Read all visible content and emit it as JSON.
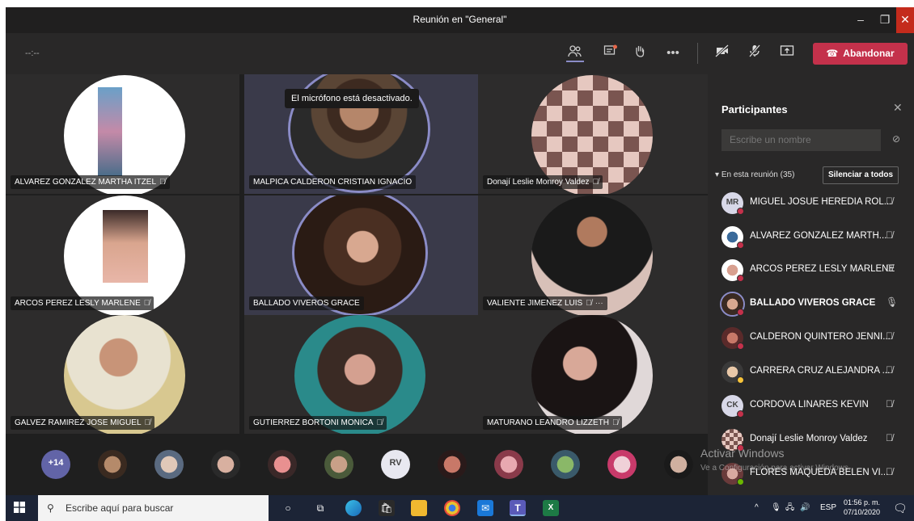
{
  "window": {
    "title": "Reunión en \"General\"",
    "minimize_icon": "minimize-icon",
    "maximize_icon": "maximize-icon",
    "close_icon": "close-icon"
  },
  "toolbar": {
    "timer": "--:--",
    "leave_label": "Abandonar",
    "leave_color": "#c4314b"
  },
  "tooltip": "El micrófono está desactivado.",
  "tiles": [
    {
      "name": "ALVAREZ GONZALEZ MARTHA ITZEL"
    },
    {
      "name": "MALPICA CALDERON CRISTIAN IGNACIO"
    },
    {
      "name": "Donají Leslie Monroy Valdez"
    },
    {
      "name": "ARCOS PEREZ LESLY MARLENE"
    },
    {
      "name": "BALLADO VIVEROS GRACE"
    },
    {
      "name": "VALIENTE JIMENEZ LUIS"
    },
    {
      "name": "GALVEZ RAMIREZ JOSE MIGUEL"
    },
    {
      "name": "GUTIERREZ BORTONI MONICA"
    },
    {
      "name": "MATURANO LEANDRO LIZZETH"
    }
  ],
  "strip": {
    "more_count": "+14",
    "initials_rv": "RV"
  },
  "panel": {
    "title": "Participantes",
    "search_placeholder": "Escribe un nombre",
    "in_meeting": "En esta reunión (35)",
    "mute_all": "Silenciar a todos",
    "participants": [
      {
        "name": "MIGUEL JOSUE HEREDIA ROL...",
        "initials": "MR"
      },
      {
        "name": "ALVAREZ GONZALEZ MARTH..."
      },
      {
        "name": "ARCOS PEREZ LESLY MARLENE"
      },
      {
        "name": "BALLADO VIVEROS GRACE"
      },
      {
        "name": "CALDERON QUINTERO JENNI..."
      },
      {
        "name": "CARRERA CRUZ ALEJANDRA ..."
      },
      {
        "name": "CORDOVA LINARES KEVIN",
        "initials": "CK"
      },
      {
        "name": "Donají Leslie Monroy Valdez"
      },
      {
        "name": "FLORES MAQUEDA BELEN VI..."
      }
    ]
  },
  "watermark": {
    "line1": "Activar Windows",
    "line2": "Ve a Configuración para activar Windows."
  },
  "taskbar": {
    "search_placeholder": "Escribe aquí para buscar",
    "lang": "ESP",
    "time": "01:56 p. m.",
    "date": "07/10/2020"
  }
}
